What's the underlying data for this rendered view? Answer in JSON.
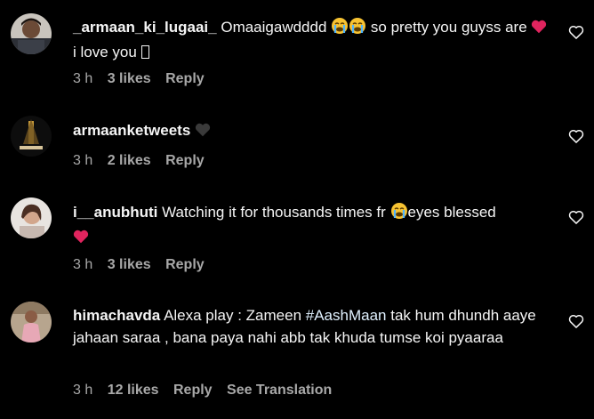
{
  "colors": {
    "background": "#000000",
    "primary_text": "#f5f5f5",
    "secondary_text": "#a8a8a8",
    "heart_red": "#e0245e",
    "black_heart": "#3a3a3a"
  },
  "comments": [
    {
      "username": "_armaan_ki_lugaai_",
      "text_part1": "Omaaigawdddd",
      "text_part2": "so pretty you guyss are",
      "text_part3": "i love you",
      "time": "3 h",
      "likes": "3 likes",
      "reply": "Reply",
      "icons": [
        "crying-emoji",
        "crying-emoji",
        "red-heart-emoji",
        "tofu-glyph"
      ]
    },
    {
      "username": "armaanketweets",
      "time": "3 h",
      "likes": "2 likes",
      "reply": "Reply",
      "icons": [
        "black-heart-emoji"
      ]
    },
    {
      "username": "i__anubhuti",
      "text_part1": "Watching it for thousands times fr",
      "text_part2": "eyes blessed",
      "time": "3 h",
      "likes": "3 likes",
      "reply": "Reply",
      "icons": [
        "crying-emoji",
        "red-heart-emoji"
      ]
    },
    {
      "username": "himachavda",
      "text_part1": "Alexa play : Zameen",
      "hashtag": "#AashMaan",
      "text_part2": "tak hum dhundh aaye jahaan saraa , bana paya nahi abb tak khuda tumse koi pyaaraa",
      "time": "3 h",
      "likes": "12 likes",
      "reply": "Reply",
      "see_translation": "See Translation"
    }
  ]
}
